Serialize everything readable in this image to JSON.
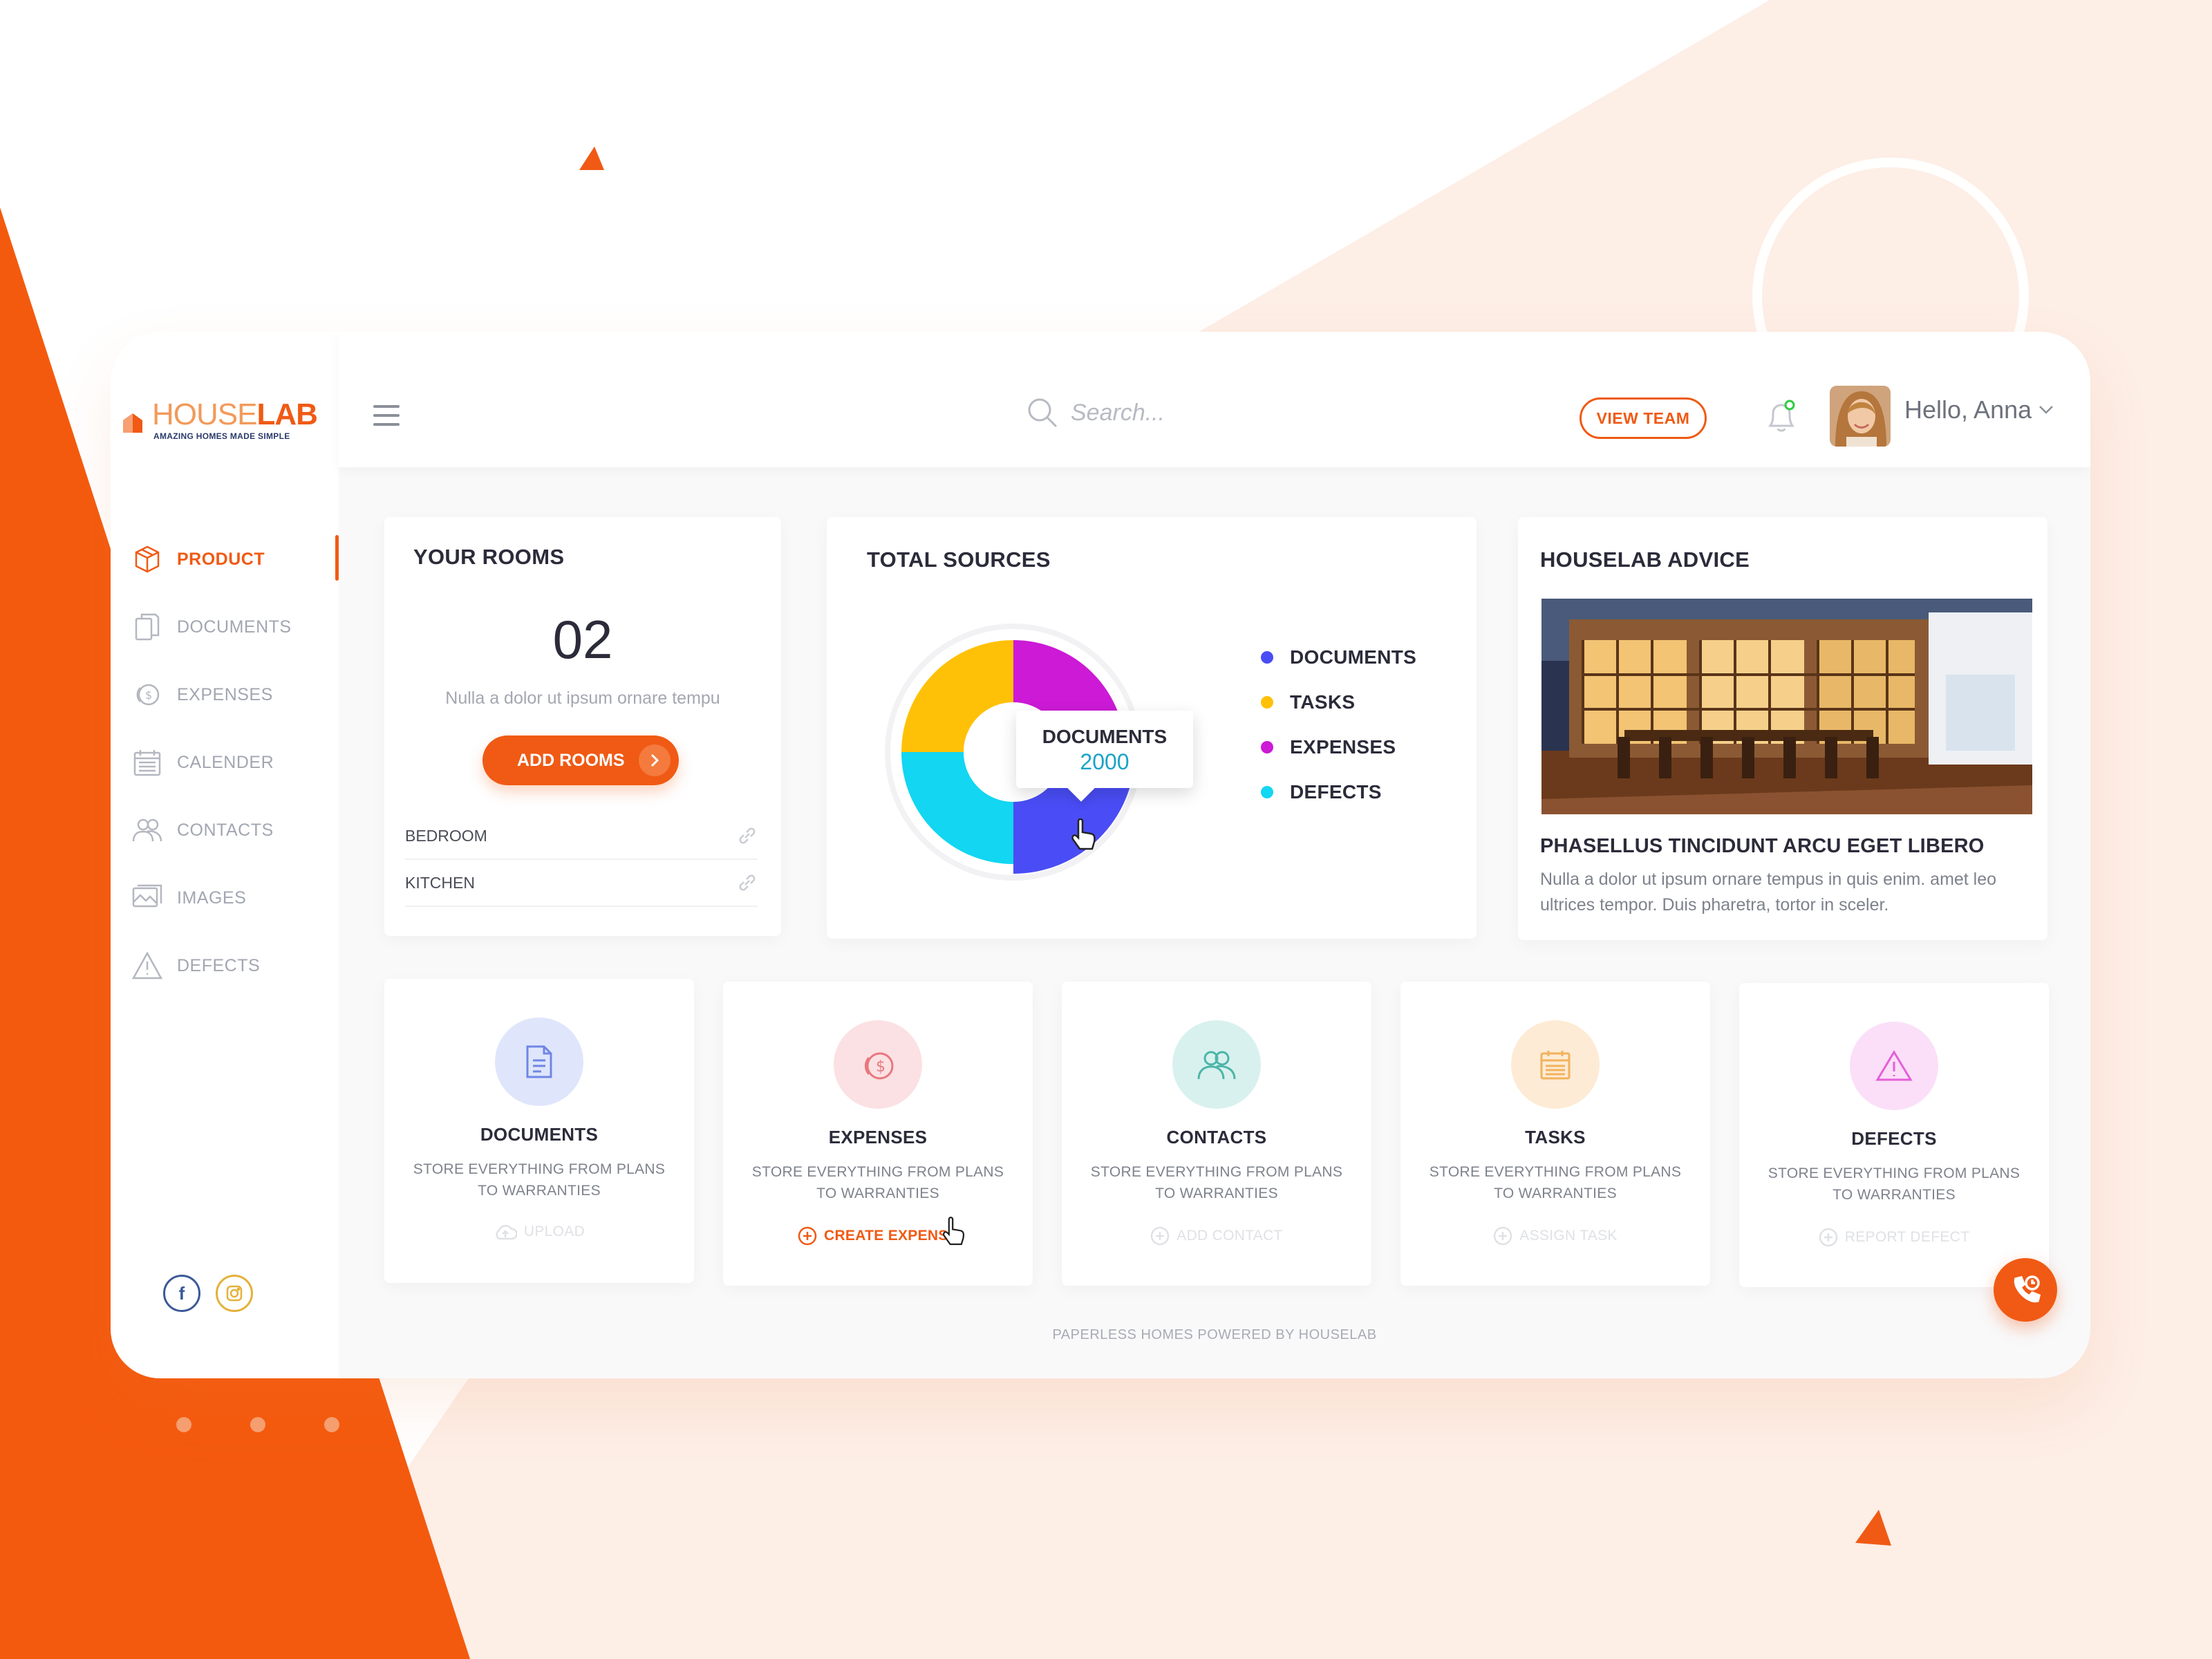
{
  "colors": {
    "accent": "#f05a14",
    "background_peach": "#fdeee6",
    "documents": "#4a4df5",
    "tasks": "#ffc107",
    "expenses": "#cc1ad6",
    "defects": "#12d6f2"
  },
  "brand": {
    "logo_part1": "HOUSE",
    "logo_part2": "LAB",
    "tagline": "AMAZING HOMES MADE SIMPLE"
  },
  "sidebar": {
    "items": [
      {
        "label": "PRODUCT",
        "icon": "box-icon",
        "active": true
      },
      {
        "label": "DOCUMENTS",
        "icon": "documents-icon"
      },
      {
        "label": "EXPENSES",
        "icon": "coins-icon"
      },
      {
        "label": "CALENDER",
        "icon": "calendar-icon"
      },
      {
        "label": "CONTACTS",
        "icon": "contacts-icon"
      },
      {
        "label": "IMAGES",
        "icon": "images-icon"
      },
      {
        "label": "DEFECTS",
        "icon": "warning-icon"
      }
    ],
    "social": {
      "facebook": "f",
      "instagram": "instagram-icon"
    }
  },
  "header": {
    "search_placeholder": "Search...",
    "view_team": "VIEW TEAM",
    "greeting": "Hello, Anna"
  },
  "rooms": {
    "title": "YOUR ROOMS",
    "count": "02",
    "subtitle": "Nulla a dolor ut ipsum ornare tempu",
    "add_button": "ADD ROOMS",
    "list": [
      "BEDROOM",
      "KITCHEN"
    ]
  },
  "sources": {
    "title": "TOTAL SOURCES",
    "tooltip_label": "DOCUMENTS",
    "tooltip_value": "2000"
  },
  "chart_data": {
    "type": "pie",
    "categories": [
      "DOCUMENTS",
      "TASKS",
      "EXPENSES",
      "DEFECTS"
    ],
    "values": [
      2000,
      2000,
      2000,
      2000
    ],
    "colors": [
      "#4a4df5",
      "#ffc107",
      "#cc1ad6",
      "#12d6f2"
    ],
    "legend": "right"
  },
  "advice": {
    "title": "HOUSELAB ADVICE",
    "heading": "PHASELLUS TINCIDUNT ARCU EGET LIBERO",
    "body": "Nulla a dolor ut ipsum ornare tempus in quis enim. amet leo ultrices tempor. Duis pharetra, tortor in sceler."
  },
  "features": [
    {
      "title": "DOCUMENTS",
      "desc": "STORE EVERYTHING FROM PLANS TO WARRANTIES",
      "action": "UPLOAD",
      "icon": "document-icon",
      "circle": "#dfe6fb",
      "icolor": "#6f86e6"
    },
    {
      "title": "EXPENSES",
      "desc": "STORE EVERYTHING FROM PLANS TO WARRANTIES",
      "action": "CREATE EXPENSE",
      "icon": "coins-icon",
      "circle": "#fbe1e3",
      "icolor": "#e9787e"
    },
    {
      "title": "CONTACTS",
      "desc": "STORE EVERYTHING FROM PLANS TO WARRANTIES",
      "action": "ADD CONTACT",
      "icon": "contacts-icon",
      "circle": "#d8f1ee",
      "icolor": "#4cb5a9"
    },
    {
      "title": "TASKS",
      "desc": "STORE EVERYTHING FROM PLANS TO WARRANTIES",
      "action": "ASSIGN TASK",
      "icon": "calendar-icon",
      "circle": "#fdebd5",
      "icolor": "#f2b25c"
    },
    {
      "title": "DEFECTS",
      "desc": "STORE EVERYTHING FROM PLANS TO WARRANTIES",
      "action": "REPORT DEFECT",
      "icon": "warning-icon",
      "circle": "#fbdff8",
      "icolor": "#e55fd9"
    }
  ],
  "footer": "PAPERLESS HOMES POWERED BY HOUSELAB"
}
